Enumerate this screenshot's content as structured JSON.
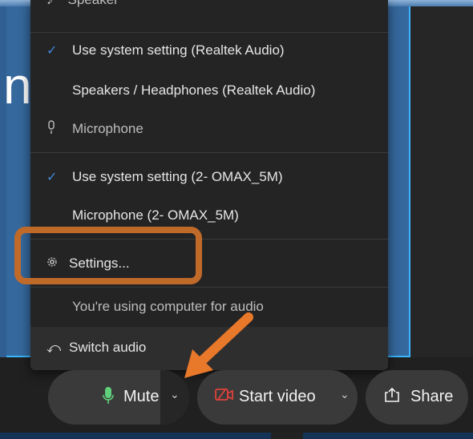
{
  "slide": {
    "text": "ne"
  },
  "menu": {
    "speaker_header": "Speaker",
    "speaker_options": [
      {
        "label": "Use system setting (Realtek Audio)",
        "checked": true
      },
      {
        "label": "Speakers / Headphones (Realtek Audio)",
        "checked": false
      }
    ],
    "microphone_header": "Microphone",
    "microphone_options": [
      {
        "label": "Use system setting (2- OMAX_5M)",
        "checked": true
      },
      {
        "label": "Microphone (2- OMAX_5M)",
        "checked": false
      }
    ],
    "settings_label": "Settings...",
    "status_text": "You're using computer for audio",
    "switch_audio_label": "Switch audio"
  },
  "toolbar": {
    "mute_label": "Mute",
    "start_video_label": "Start video",
    "share_label": "Share"
  },
  "colors": {
    "highlight": "#c06a2a",
    "arrow": "#e8782a",
    "check": "#3f88d8",
    "mic_green": "#5fcf7b",
    "video_red": "#e0413a"
  },
  "icons": {
    "check": "check-icon",
    "microphone": "microphone-icon",
    "gear": "gear-icon",
    "switch_audio": "switch-audio-icon",
    "chevron": "chevron-down-icon",
    "video_off": "video-off-icon",
    "share": "share-icon"
  }
}
